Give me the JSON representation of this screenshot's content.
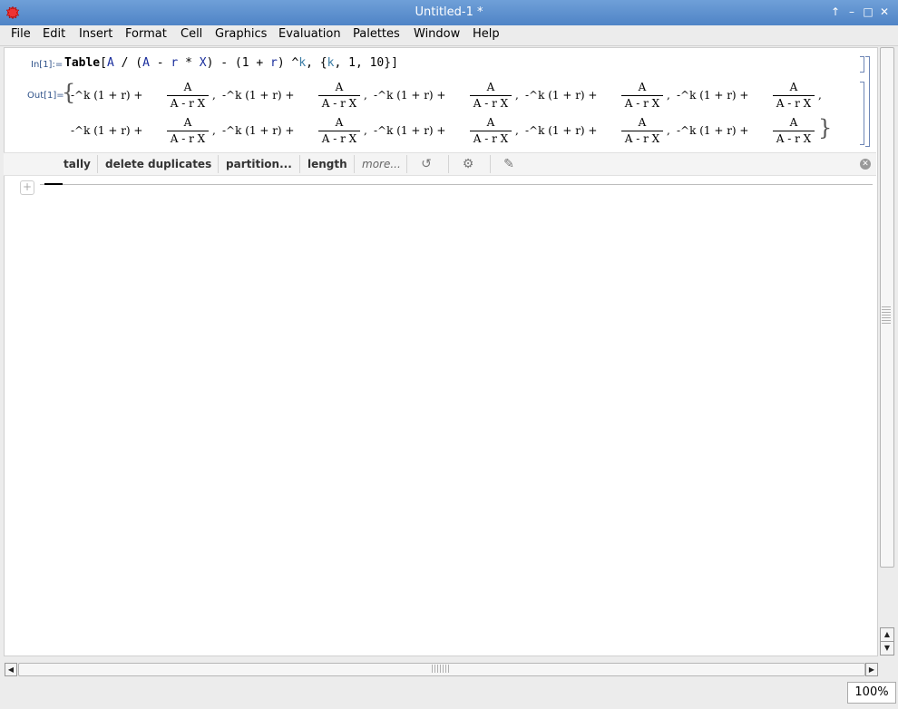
{
  "window": {
    "title": "Untitled-1 *"
  },
  "menu": [
    "File",
    "Edit",
    "Insert",
    "Format",
    "Cell",
    "Graphics",
    "Evaluation",
    "Palettes",
    "Window",
    "Help"
  ],
  "cells": {
    "in_label": "In[1]:=",
    "out_label": "Out[1]=",
    "input_parts": [
      "Table",
      "[",
      "A",
      " / (",
      "A",
      " - ",
      "r",
      " * ",
      "X",
      ") - (1 + ",
      "r",
      ") ^",
      "k",
      ", {",
      "k",
      ", 1, 10}]"
    ],
    "output_term": {
      "neg": "-^k (1 + r) +",
      "num": "A",
      "den": "A - r X"
    }
  },
  "suggestions": {
    "buttons": [
      "tally",
      "delete duplicates",
      "partition...",
      "length"
    ],
    "more": "more..."
  },
  "zoom": "100%",
  "icons": [
    "app-icon",
    "up-arrow-icon",
    "minimize-icon",
    "maximize-icon",
    "close-icon",
    "refresh-icon",
    "gear-icon",
    "comment-icon",
    "close-circle-icon"
  ]
}
